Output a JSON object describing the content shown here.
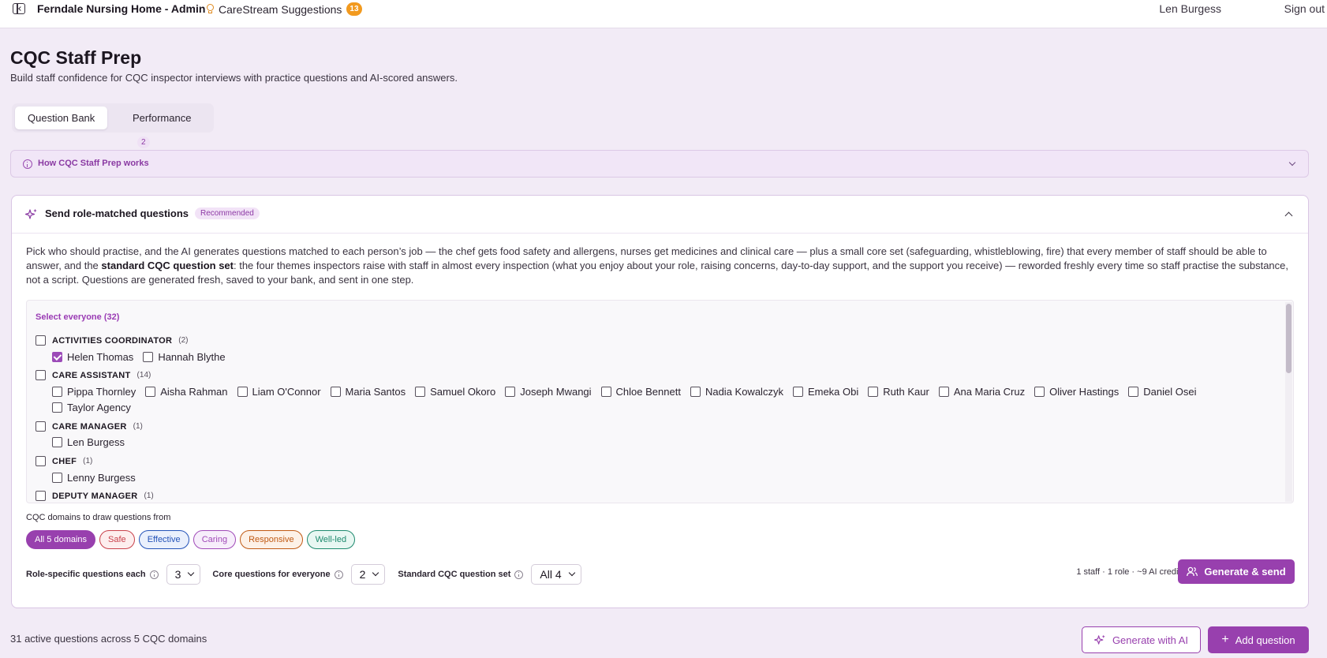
{
  "header": {
    "app_title": "Ferndale Nursing Home - Admin",
    "suggestions_label": "CareStream Suggestions",
    "suggestions_count": "13",
    "user_name": "Len Burgess",
    "sign_out": "Sign out"
  },
  "page": {
    "title": "CQC Staff Prep",
    "subtitle": "Build staff confidence for CQC inspector interviews with practice questions and AI-scored answers."
  },
  "tabs": [
    {
      "label": "Question Bank",
      "active": true
    },
    {
      "label": "Performance",
      "badge": "2",
      "active": false
    }
  ],
  "how_it_works": {
    "label": "How CQC Staff Prep works"
  },
  "send_card": {
    "title": "Send role-matched questions",
    "badge": "Recommended",
    "description_part1": "Pick who should practise, and the AI generates questions matched to each person’s job — the chef gets food safety and allergens, nurses get medicines and clinical care — plus a small core set (safeguarding, whistleblowing, fire) that every member of staff should be able to answer, and the ",
    "description_bold": "standard CQC question set",
    "description_part2": ": the four themes inspectors raise with staff in almost every inspection (what you enjoy about your role, raising concerns, day-to-day support, and the support you receive) — reworded freshly every time so staff practise the substance, not a script. Questions are generated fresh, saved to your bank, and sent in one step.",
    "select_everyone": "Select everyone (32)",
    "roles": [
      {
        "name": "ACTIVITIES COORDINATOR",
        "count": "(2)",
        "checked": false,
        "staff": [
          {
            "name": "Helen Thomas",
            "checked": true
          },
          {
            "name": "Hannah Blythe",
            "checked": false
          }
        ]
      },
      {
        "name": "CARE ASSISTANT",
        "count": "(14)",
        "checked": false,
        "staff": [
          {
            "name": "Pippa Thornley",
            "checked": false
          },
          {
            "name": "Aisha Rahman",
            "checked": false
          },
          {
            "name": "Liam O'Connor",
            "checked": false
          },
          {
            "name": "Maria Santos",
            "checked": false
          },
          {
            "name": "Samuel Okoro",
            "checked": false
          },
          {
            "name": "Joseph Mwangi",
            "checked": false
          },
          {
            "name": "Chloe Bennett",
            "checked": false
          },
          {
            "name": "Nadia Kowalczyk",
            "checked": false
          },
          {
            "name": "Emeka Obi",
            "checked": false
          },
          {
            "name": "Ruth Kaur",
            "checked": false
          },
          {
            "name": "Ana Maria Cruz",
            "checked": false
          },
          {
            "name": "Oliver Hastings",
            "checked": false
          },
          {
            "name": "Daniel Osei",
            "checked": false
          },
          {
            "name": "Taylor Agency",
            "checked": false
          }
        ]
      },
      {
        "name": "CARE MANAGER",
        "count": "(1)",
        "checked": false,
        "staff": [
          {
            "name": "Len Burgess",
            "checked": false
          }
        ]
      },
      {
        "name": "CHEF",
        "count": "(1)",
        "checked": false,
        "staff": [
          {
            "name": "Lenny Burgess",
            "checked": false
          }
        ]
      },
      {
        "name": "DEPUTY MANAGER",
        "count": "(1)",
        "checked": false,
        "staff": []
      }
    ],
    "domains_label": "CQC domains to draw questions from",
    "domains": [
      {
        "label": "All 5 domains",
        "selected": true,
        "color": "#9840ae"
      },
      {
        "label": "Safe",
        "selected": false,
        "color": "#c8414b"
      },
      {
        "label": "Effective",
        "selected": false,
        "color": "#2453b8"
      },
      {
        "label": "Caring",
        "selected": false,
        "color": "#a04ab8"
      },
      {
        "label": "Responsive",
        "selected": false,
        "color": "#c05a14"
      },
      {
        "label": "Well-led",
        "selected": false,
        "color": "#1e8a6e"
      }
    ],
    "controls": {
      "role_specific_label": "Role-specific questions each",
      "role_specific_value": "3",
      "core_label": "Core questions for everyone",
      "core_value": "2",
      "standard_label": "Standard CQC question set",
      "standard_value": "All 4"
    },
    "credit_summary": "1 staff · 1 role · ~9 AI credits",
    "generate_send": "Generate & send"
  },
  "footer": {
    "active_summary": "31 active questions across 5 CQC domains",
    "generate_ai": "Generate with AI",
    "add_question": "Add question"
  },
  "colors": {
    "accent": "#9840ae",
    "page_bg": "#f2ebf6",
    "badge_orange": "#f29a1f"
  }
}
